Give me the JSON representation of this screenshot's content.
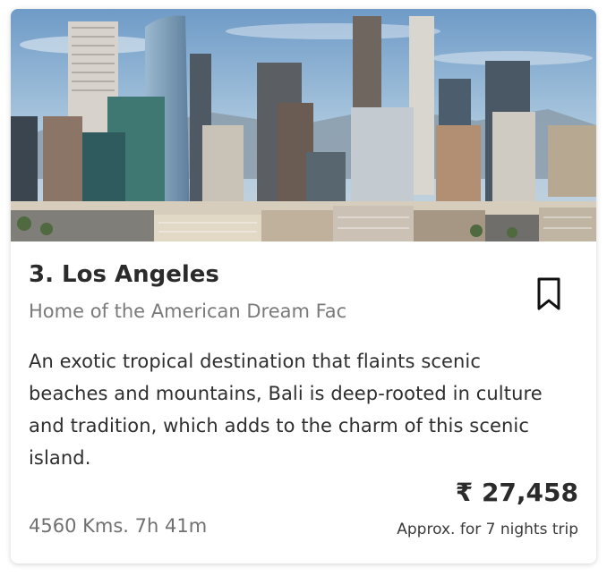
{
  "card": {
    "image_alt_subject": "Los Angeles skyline",
    "title": "3. Los Angeles",
    "subtitle": "Home of the American Dream Fac",
    "description": "An exotic tropical destination that flaints scenic beaches and mountains, Bali is deep-rooted in culture and tradition, which adds to the charm of this scenic island.",
    "price": "₹ 27,458",
    "price_note": "Approx. for 7 nights trip",
    "distance": "4560 Kms. 7h 41m",
    "bookmark_icon": "bookmark-outline-icon"
  },
  "colors": {
    "title": "#2b2b2b",
    "subtitle": "#7a7a7a",
    "sky": "#a9c6dd",
    "mountain": "#8a9aa8"
  }
}
